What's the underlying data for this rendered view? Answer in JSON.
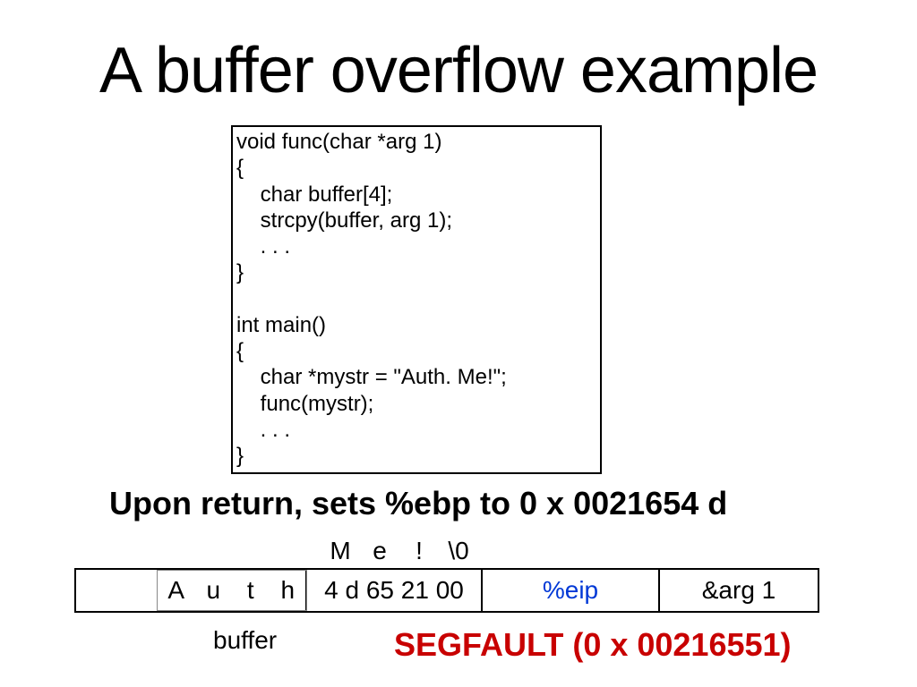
{
  "title": "A buffer overflow example",
  "code": {
    "l1": "void func(char *arg 1)",
    "l2": "{",
    "l3": "    char buffer[4];",
    "l4": "    strcpy(buffer, arg 1);",
    "l5": "    . . .",
    "l6": "}",
    "l7": "",
    "l8": "int main()",
    "l9": "{",
    "l10": "    char *mystr = \"Auth. Me!\";",
    "l11": "    func(mystr);",
    "l12": "    . . .",
    "l13": "}"
  },
  "return_line": "Upon return, sets %ebp to 0 x 0021654 d",
  "chars": {
    "c1": "M",
    "c2": "e",
    "c3": "!",
    "c4": "\\0"
  },
  "auth": {
    "a1": "A",
    "a2": "u",
    "a3": "t",
    "a4": "h"
  },
  "hex": "4 d 65 21 00",
  "eip": "%eip",
  "arg": "&arg 1",
  "buffer_label": "buffer",
  "segfault": "SEGFAULT (0 x 00216551)"
}
